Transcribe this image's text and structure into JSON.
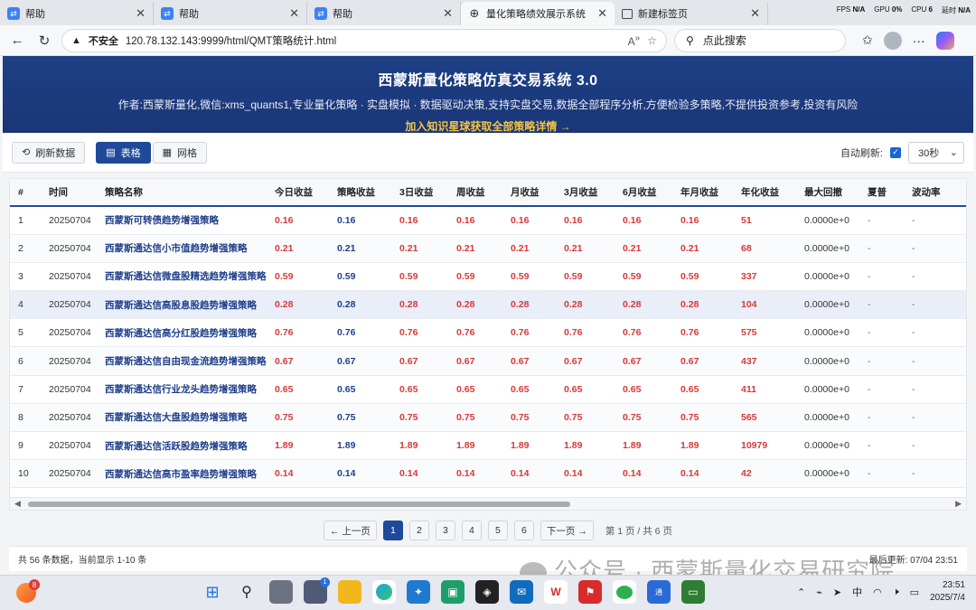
{
  "browser": {
    "tabs": [
      {
        "label": "帮助",
        "icon": "app-icon",
        "active": false
      },
      {
        "label": "帮助",
        "icon": "app-icon",
        "active": false
      },
      {
        "label": "帮助",
        "icon": "app-icon",
        "active": false
      },
      {
        "label": "量化策略绩效展示系统",
        "icon": "globe-icon",
        "active": true
      },
      {
        "label": "新建标签页",
        "icon": "page-icon",
        "active": false
      }
    ],
    "perf": {
      "fps_label": "FPS",
      "fps_value": "N/A",
      "gpu_label": "GPU",
      "gpu_value": "0%",
      "cpu_label": "CPU",
      "cpu_value": "6",
      "lat_label": "延时",
      "lat_value": "N/A"
    },
    "security": "不安全",
    "url": "120.78.132.143:9999/html/QMT策略统计.html",
    "search_placeholder": "点此搜索"
  },
  "hero": {
    "title": "西蒙斯量化策略仿真交易系统 3.0",
    "subtitle": "作者:西蒙斯量化,微信:xms_quants1,专业量化策略 · 实盘模拟 · 数据驱动决策,支持实盘交易,数据全部程序分析,方便检验多策略,不提供投资参考,投资有风险",
    "link": "加入知识星球获取全部策略详情 →"
  },
  "toolbar": {
    "refresh": "刷新数据",
    "view_table": "表格",
    "view_grid": "网格",
    "auto_refresh_label": "自动刷新:",
    "interval": "30秒"
  },
  "table": {
    "columns": [
      "#",
      "时间",
      "策略名称",
      "今日收益",
      "策略收益",
      "3日收益",
      "周收益",
      "月收益",
      "3月收益",
      "6月收益",
      "年月收益",
      "年化收益",
      "最大回撤",
      "夏普",
      "波动率"
    ],
    "rows": [
      [
        "1",
        "20250704",
        "西蒙斯可转债趋势增强策略",
        "0.16",
        "0.16",
        "0.16",
        "0.16",
        "0.16",
        "0.16",
        "0.16",
        "0.16",
        "51",
        "0.0000e+0",
        "-",
        "-"
      ],
      [
        "2",
        "20250704",
        "西蒙斯通达信小市值趋势增强策略",
        "0.21",
        "0.21",
        "0.21",
        "0.21",
        "0.21",
        "0.21",
        "0.21",
        "0.21",
        "68",
        "0.0000e+0",
        "-",
        "-"
      ],
      [
        "3",
        "20250704",
        "西蒙斯通达信微盘股精选趋势增强策略",
        "0.59",
        "0.59",
        "0.59",
        "0.59",
        "0.59",
        "0.59",
        "0.59",
        "0.59",
        "337",
        "0.0000e+0",
        "-",
        "-"
      ],
      [
        "4",
        "20250704",
        "西蒙斯通达信高股息股趋势增强策略",
        "0.28",
        "0.28",
        "0.28",
        "0.28",
        "0.28",
        "0.28",
        "0.28",
        "0.28",
        "104",
        "0.0000e+0",
        "-",
        "-"
      ],
      [
        "5",
        "20250704",
        "西蒙斯通达信高分红股趋势增强策略",
        "0.76",
        "0.76",
        "0.76",
        "0.76",
        "0.76",
        "0.76",
        "0.76",
        "0.76",
        "575",
        "0.0000e+0",
        "-",
        "-"
      ],
      [
        "6",
        "20250704",
        "西蒙斯通达信自由现金流趋势增强策略",
        "0.67",
        "0.67",
        "0.67",
        "0.67",
        "0.67",
        "0.67",
        "0.67",
        "0.67",
        "437",
        "0.0000e+0",
        "-",
        "-"
      ],
      [
        "7",
        "20250704",
        "西蒙斯通达信行业龙头趋势增强策略",
        "0.65",
        "0.65",
        "0.65",
        "0.65",
        "0.65",
        "0.65",
        "0.65",
        "0.65",
        "411",
        "0.0000e+0",
        "-",
        "-"
      ],
      [
        "8",
        "20250704",
        "西蒙斯通达信大盘股趋势增强策略",
        "0.75",
        "0.75",
        "0.75",
        "0.75",
        "0.75",
        "0.75",
        "0.75",
        "0.75",
        "565",
        "0.0000e+0",
        "-",
        "-"
      ],
      [
        "9",
        "20250704",
        "西蒙斯通达信活跃股趋势增强策略",
        "1.89",
        "1.89",
        "1.89",
        "1.89",
        "1.89",
        "1.89",
        "1.89",
        "1.89",
        "10979",
        "0.0000e+0",
        "-",
        "-"
      ],
      [
        "10",
        "20250704",
        "西蒙斯通达信高市盈率趋势增强策略",
        "0.14",
        "0.14",
        "0.14",
        "0.14",
        "0.14",
        "0.14",
        "0.14",
        "0.14",
        "42",
        "0.0000e+0",
        "-",
        "-"
      ]
    ],
    "highlighted_row": 3
  },
  "pager": {
    "prev": "← 上一页",
    "pages": [
      "1",
      "2",
      "3",
      "4",
      "5",
      "6"
    ],
    "current": "1",
    "next": "下一页 →",
    "info": "第 1 页 / 共 6 页"
  },
  "footer": {
    "summary": "共 56 条数据，当前显示 1-10 条",
    "updated": "最后更新: 07/04 23:51"
  },
  "watermark": "公众号 · 西蒙斯量化交易研究院",
  "taskbar": {
    "weather_badge": "8",
    "store_badge": "1",
    "ime": "中",
    "time": "23:51",
    "date": "2025/7/4"
  },
  "colors": {
    "brand": "#1f4a9a",
    "hero_bg": "#1e3f86",
    "positive": "#d63a3a",
    "accent_link": "#f5c542"
  }
}
